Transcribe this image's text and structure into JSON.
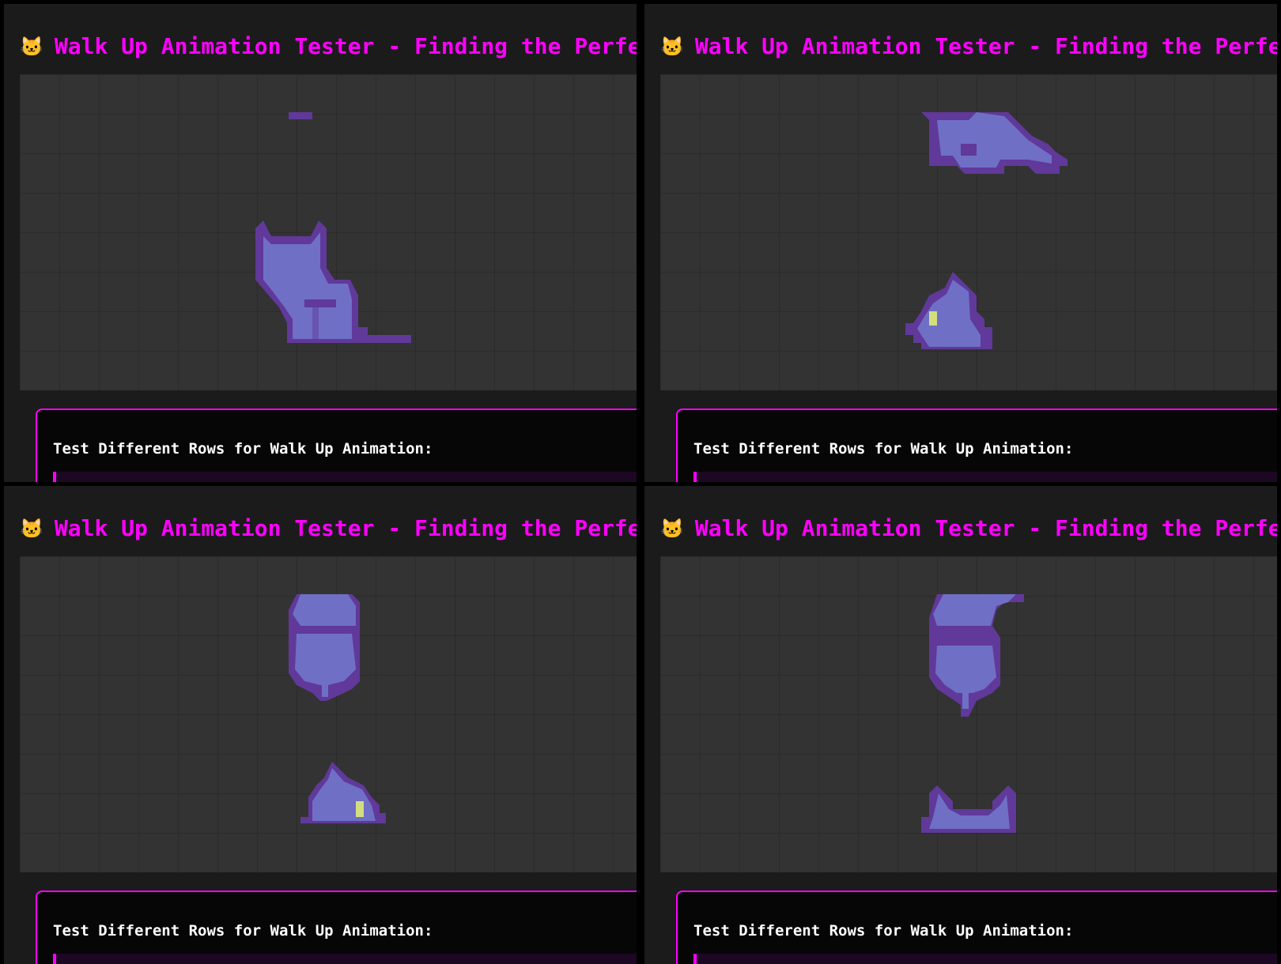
{
  "window": {
    "icon": "cat-face-icon",
    "title": "🐱",
    "heading": "Walk Up Animation Tester - Finding the Perfect R"
  },
  "controls": {
    "label": "Test Different Rows for Walk Up Animation:"
  },
  "colors": {
    "accent": "#ff00ff",
    "canvas": "#333333",
    "grid": "#2b2b2b",
    "sprite_body": "#6f6fc6",
    "sprite_outline": "#60399a",
    "sprite_eye": "#d3de7f"
  },
  "panels": [
    {
      "frame": "1",
      "top_sprite": "tail-tip",
      "bottom_sprite": "cat-sitting-side"
    },
    {
      "frame": "2",
      "top_sprite": "cat-lying",
      "bottom_sprite": "cat-head-left"
    },
    {
      "frame": "3",
      "top_sprite": "cat-back-view",
      "bottom_sprite": "cat-head-right"
    },
    {
      "frame": "4",
      "top_sprite": "cat-back-view-tail",
      "bottom_sprite": "cat-ears"
    }
  ]
}
